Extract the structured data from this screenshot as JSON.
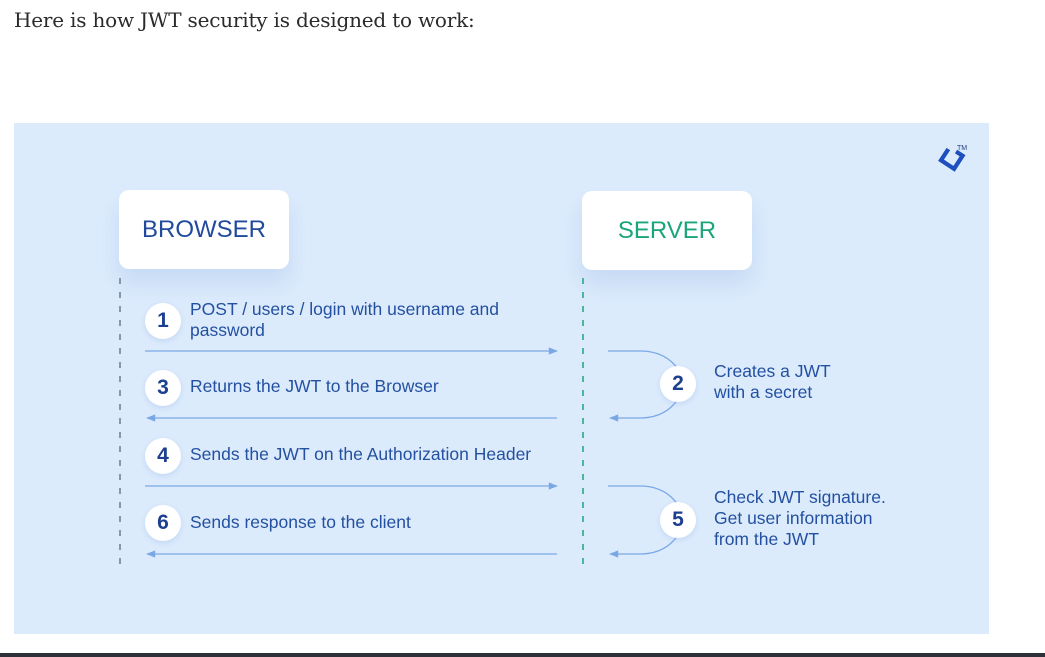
{
  "intro_text": "Here is how JWT security is designed to work:",
  "diagram": {
    "browser_label": "BROWSER",
    "server_label": "SERVER",
    "logo_tm": "TM",
    "steps": [
      {
        "num": "1",
        "text": "POST / users / login with username and password"
      },
      {
        "num": "2",
        "text": "Creates a JWT with a secret"
      },
      {
        "num": "3",
        "text": "Returns the JWT to the Browser"
      },
      {
        "num": "4",
        "text": "Sends the JWT on the Authorization Header"
      },
      {
        "num": "5",
        "text": "Check JWT signature. Get user information from the JWT"
      },
      {
        "num": "6",
        "text": "Sends response to the client"
      }
    ],
    "colors": {
      "background": "#dcebfc",
      "browser_text": "#204a9c",
      "server_text": "#1aa57a",
      "arrow": "#7aa8e6",
      "step_text": "#2350a0"
    }
  }
}
